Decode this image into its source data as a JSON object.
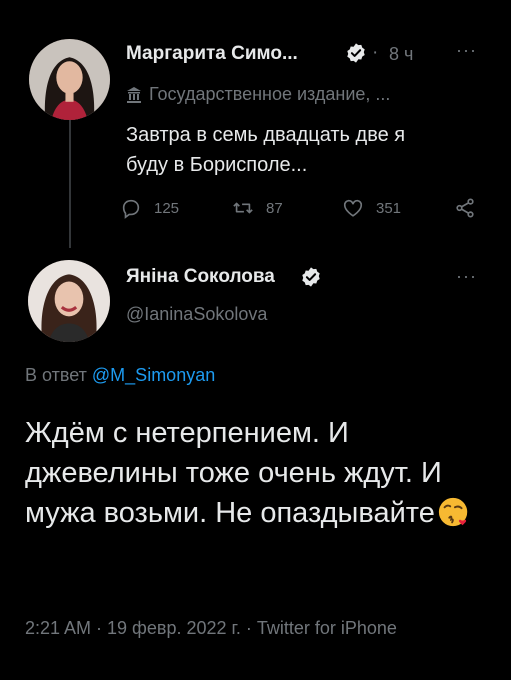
{
  "tweet1": {
    "author_name": "Маргарита Симо...",
    "time_separator": "·",
    "time": "8 ч",
    "more_icon": "···",
    "label": "Государственное издание, ...",
    "text": "Завтра в семь двадцать две я\nбуду в Борисполе...",
    "replies": "125",
    "retweets": "87",
    "likes": "351"
  },
  "tweet2": {
    "author_name": "Яніна Соколова",
    "handle": "@IaninaSokolova",
    "more_icon": "···",
    "reply_prefix": "В ответ",
    "reply_mention": "@M_Simonyan",
    "text": "Ждём с нетерпением. И джевелины тоже очень ждут. И мужа возьми. Не опаздывайте",
    "meta": "2:21 AM · 19 февр. 2022 г. · Twitter for iPhone"
  },
  "colors": {
    "background": "#000000",
    "text": "#e7e9ea",
    "secondary": "#71767b",
    "accent": "#1d9bf0"
  },
  "icons": [
    "verified-badge-icon",
    "government-building-icon",
    "reply-icon",
    "retweet-icon",
    "like-icon",
    "share-icon",
    "kiss-emoji-icon"
  ]
}
